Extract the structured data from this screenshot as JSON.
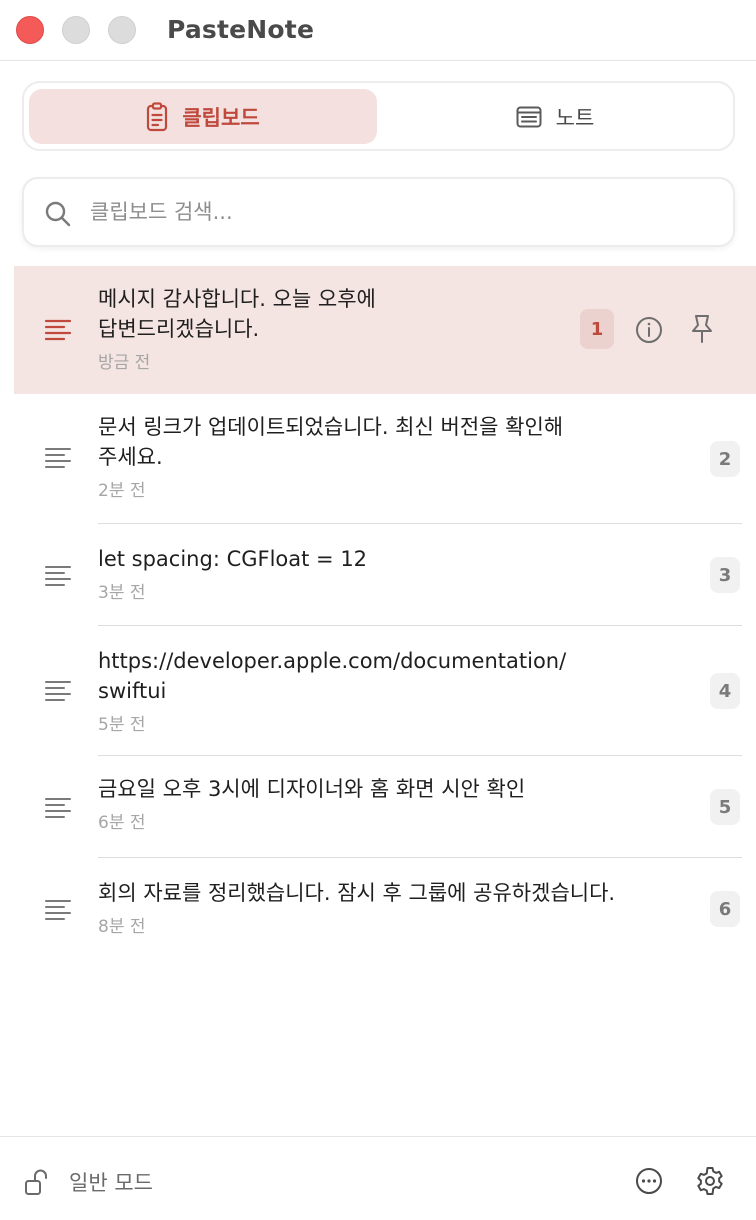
{
  "app": {
    "title": "PasteNote"
  },
  "tabs": [
    {
      "label": "클립보드",
      "icon": "clipboard-icon",
      "active": true
    },
    {
      "label": "노트",
      "icon": "note-icon",
      "active": false
    }
  ],
  "search": {
    "placeholder": "클립보드 검색...",
    "value": "",
    "icon": "search-icon"
  },
  "clips": [
    {
      "line1": "메시지 감사합니다. 오늘 오후에",
      "line2": "답변드리겠습니다.",
      "time": "방금 전",
      "index": "1",
      "selected": true
    },
    {
      "line1": "문서 링크가 업데이트되었습니다. 최신 버전을 확인해",
      "line2": "주세요.",
      "time": "2분 전",
      "index": "2",
      "selected": false
    },
    {
      "line1": "let spacing: CGFloat = 12",
      "line2": "",
      "time": "3분 전",
      "index": "3",
      "selected": false
    },
    {
      "line1": "https://developer.apple.com/documentation/",
      "line2": "swiftui",
      "time": "5분 전",
      "index": "4",
      "selected": false
    },
    {
      "line1": "금요일 오후 3시에 디자이너와 홈 화면 시안 확인",
      "line2": "",
      "time": "6분 전",
      "index": "5",
      "selected": false
    },
    {
      "line1": "회의 자료를 정리했습니다. 잠시 후 그룹에 공유하겠습니다.",
      "line2": "",
      "time": "8분 전",
      "index": "6",
      "selected": false
    }
  ],
  "footer": {
    "mode_label": "일반 모드",
    "lock_icon": "unlock-icon",
    "more_icon": "ellipsis-circle-icon",
    "settings_icon": "gear-icon"
  },
  "colors": {
    "accent": "#c0493e",
    "selected_bg": "#f4e4e2",
    "close": "#f45a57"
  }
}
